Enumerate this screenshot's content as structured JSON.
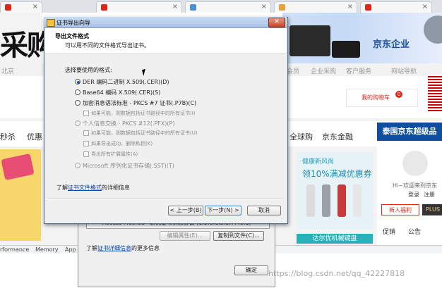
{
  "wizard": {
    "title": "证书导出向导",
    "close_label": "✕",
    "header_title": "导出文件格式",
    "header_subtitle": "可以用不同的文件格式导出证书。",
    "prompt": "选择要使用的格式:",
    "options": [
      {
        "label": "DER 编码二进制 X.509(.CER)(D)",
        "selected": true,
        "enabled": true
      },
      {
        "label": "Base64 编码 X.509(.CER)(S)",
        "selected": false,
        "enabled": true
      },
      {
        "label": "加密消息语法标准 - PKCS #7 证书(.P7B)(C)",
        "selected": false,
        "enabled": true
      },
      {
        "label": "如果可能，则数据包括证书路径中的所有证书(I)",
        "type": "checkbox",
        "enabled": false
      },
      {
        "label": "个人信息交换 - PKCS #12(.PFX)(P)",
        "selected": false,
        "enabled": false
      },
      {
        "label": "如果可能，则数据包括证书路径中的所有证书(U)",
        "type": "checkbox",
        "enabled": false
      },
      {
        "label": "如果导出成功，删除私钥(K)",
        "type": "checkbox",
        "enabled": false
      },
      {
        "label": "导出所有扩展属性(A)",
        "type": "checkbox",
        "enabled": false
      },
      {
        "label": "Microsoft 序列化证书存储(.SST)(T)",
        "selected": false,
        "enabled": false
      }
    ],
    "info_prefix": "了解",
    "info_link": "证书文件格式",
    "info_suffix": "的详细信息",
    "back_label": "< 上一步(B)",
    "next_label": "下一步(N) >",
    "cancel_label": "取消"
  },
  "cert_dialog": {
    "row_text": "Access Method=联机证书状态协议 (1.3.6.1.5.5.7.48.1)",
    "edit_label": "编辑属性(E)...",
    "copy_label": "复制到文件(C)...",
    "info_prefix": "了解",
    "info_link": "证书详细信息",
    "info_suffix": "的更多信息",
    "ok_label": "确定"
  },
  "page": {
    "banner_text": "采购.",
    "enterprise_label": "京东企业",
    "nav_items": [
      "北京",
      "会员",
      "企业采购",
      "客户服务",
      "网站导航"
    ],
    "cart_label": "我的购物车",
    "cart_count": "0",
    "categories": [
      "秒杀",
      "优惠",
      "全球购",
      "京东金融"
    ],
    "jd_tag": "泰国京东超级品",
    "promo_title": "健康新风尚",
    "promo_deal": "领10%满减优惠券",
    "promo_bottom": "达尔优机械键盘",
    "welcome": "Hi~欢迎来到京东",
    "login": "登录",
    "register": "注册",
    "newbie": "新人福利",
    "plus": "PLUS",
    "side_tabs": [
      "促销",
      "公告"
    ],
    "devtools_tabs": [
      "rformance",
      "Memory",
      "App"
    ],
    "watermark": "https://blog.csdn.net/qq_42227818"
  },
  "colors": {
    "jd_red": "#e1251b",
    "link_blue": "#0645ad",
    "title_bar": "#a9c4e6",
    "jd_blue": "#0e4ea0"
  }
}
